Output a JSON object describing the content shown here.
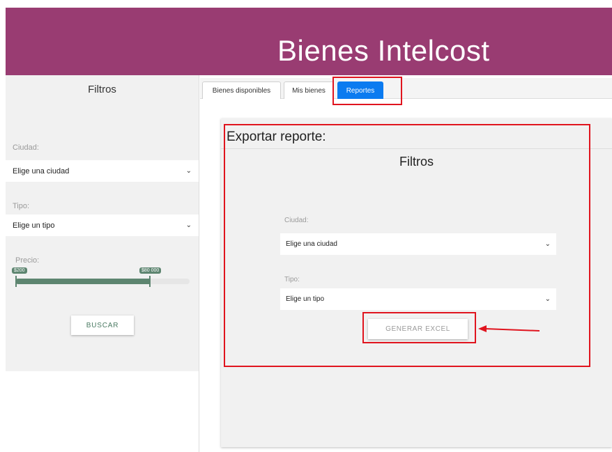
{
  "header": {
    "title": "Bienes Intelcost"
  },
  "sidebar": {
    "title": "Filtros",
    "city_label": "Ciudad:",
    "city_value": "Elige una ciudad",
    "type_label": "Tipo:",
    "type_value": "Elige un tipo",
    "price_label": "Precio:",
    "price_min": "$200",
    "price_max": "$80 000",
    "price_range_fraction": [
      0.0,
      0.77
    ],
    "search_label": "BUSCAR"
  },
  "tabs": [
    {
      "label": "Bienes disponibles",
      "active": false
    },
    {
      "label": "Mis bienes",
      "active": false
    },
    {
      "label": "Reportes",
      "active": true
    }
  ],
  "report": {
    "title": "Exportar reporte:",
    "filters_title": "Filtros",
    "city_label": "Ciudad:",
    "city_value": "Elige una ciudad",
    "type_label": "Tipo:",
    "type_value": "Elige un tipo",
    "export_label": "GENERAR EXCEL"
  },
  "colors": {
    "header_bg": "#993c72",
    "accent_green": "#5d8570",
    "active_tab": "#0b7bf0",
    "annotation_red": "#e0141e"
  },
  "icons": {
    "select_chevron": "chevron-down-icon",
    "annotation_arrow": "arrow-left-icon"
  }
}
